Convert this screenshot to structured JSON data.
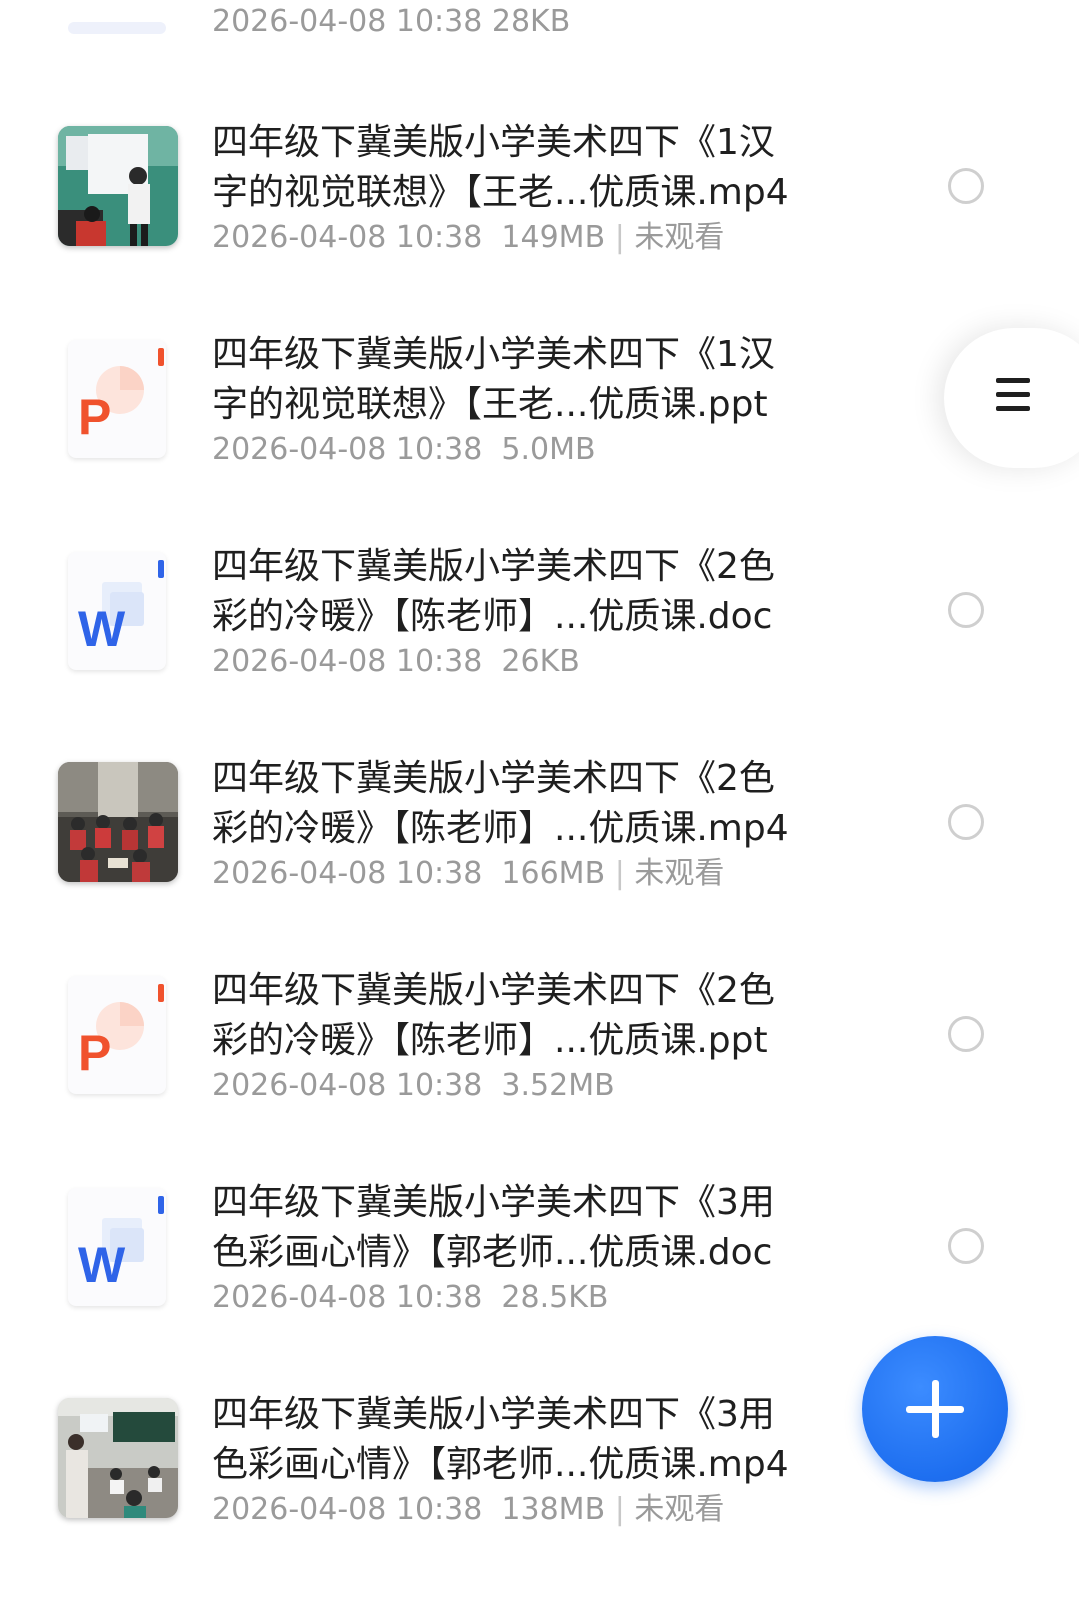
{
  "partial_top_item": {
    "meta": "2026-04-08 10:38  28KB"
  },
  "items": [
    {
      "type": "video",
      "title_line1": "四年级下冀美版小学美术四下《1汉",
      "title_line2": "字的视觉联想》【王老...优质课.mp4",
      "date": "2026-04-08 10:38",
      "size": "149MB",
      "sep": "|",
      "watch_status": "未观看",
      "thumbnail": "classroom-whiteboard-photo"
    },
    {
      "type": "ppt",
      "icon_letter": "P",
      "title_line1": "四年级下冀美版小学美术四下《1汉",
      "title_line2": "字的视觉联想》【王老...优质课.ppt",
      "date": "2026-04-08 10:38",
      "size": "5.0MB"
    },
    {
      "type": "doc",
      "icon_letter": "W",
      "title_line1": "四年级下冀美版小学美术四下《2色",
      "title_line2": "彩的冷暖》【陈老师】...优质课.doc",
      "date": "2026-04-08 10:38",
      "size": "26KB"
    },
    {
      "type": "video",
      "title_line1": "四年级下冀美版小学美术四下《2色",
      "title_line2": "彩的冷暖》【陈老师】...优质课.mp4",
      "date": "2026-04-08 10:38",
      "size": "166MB",
      "sep": "|",
      "watch_status": "未观看",
      "thumbnail": "students-in-classroom-photo"
    },
    {
      "type": "ppt",
      "icon_letter": "P",
      "title_line1": "四年级下冀美版小学美术四下《2色",
      "title_line2": "彩的冷暖》【陈老师】...优质课.ppt",
      "date": "2026-04-08 10:38",
      "size": "3.52MB"
    },
    {
      "type": "doc",
      "icon_letter": "W",
      "title_line1": "四年级下冀美版小学美术四下《3用",
      "title_line2": "色彩画心情》【郭老师...优质课.doc",
      "date": "2026-04-08 10:38",
      "size": "28.5KB"
    },
    {
      "type": "video",
      "title_line1": "四年级下冀美版小学美术四下《3用",
      "title_line2": "色彩画心情》【郭老师...优质课.mp4",
      "date": "2026-04-08 10:38",
      "size": "138MB",
      "sep": "|",
      "watch_status": "未观看",
      "thumbnail": "teacher-at-blackboard-photo"
    }
  ],
  "side_menu": {
    "icon": "hamburger-menu-icon"
  },
  "fab": {
    "icon": "plus-icon"
  },
  "colors": {
    "accent": "#1e6ff0",
    "ppt": "#f0522d",
    "word": "#2f64e8",
    "meta_text": "#9a9a9a",
    "title_text": "#1f1f1f"
  }
}
